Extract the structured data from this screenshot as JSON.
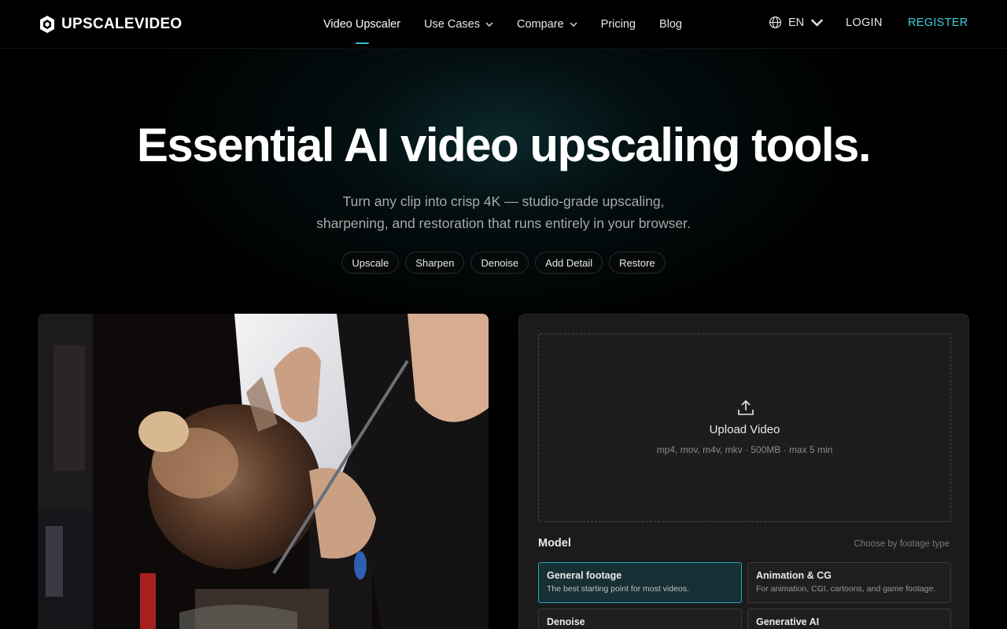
{
  "brand": {
    "name": "UPSCALEVIDEO",
    "icon": "cube-logo-icon"
  },
  "nav": {
    "items": [
      {
        "label": "Video Upscaler",
        "active": true,
        "dropdown": false
      },
      {
        "label": "Use Cases",
        "active": false,
        "dropdown": true
      },
      {
        "label": "Compare",
        "active": false,
        "dropdown": true
      },
      {
        "label": "Pricing",
        "active": false,
        "dropdown": false
      },
      {
        "label": "Blog",
        "active": false,
        "dropdown": false
      }
    ],
    "language": "EN",
    "login": "LOGIN",
    "register": "REGISTER"
  },
  "hero": {
    "title": "Essential AI video upscaling tools.",
    "subtitle_line1": "Turn any clip into crisp 4K — studio-grade upscaling,",
    "subtitle_line2": "sharpening, and restoration that runs entirely in your browser.",
    "chips": [
      "Upscale",
      "Sharpen",
      "Denoise",
      "Add Detail",
      "Restore"
    ]
  },
  "upload": {
    "title": "Upload Video",
    "hint": "mp4, mov, m4v, mkv · 500MB · max 5 min",
    "icon": "upload-icon"
  },
  "model": {
    "label": "Model",
    "hint": "Choose by footage type",
    "options": [
      {
        "title": "General footage",
        "desc": "The best starting point for most videos.",
        "selected": true
      },
      {
        "title": "Animation & CG",
        "desc": "For animation, CGI, cartoons, and game footage.",
        "selected": false
      },
      {
        "title": "Denoise",
        "desc": "",
        "selected": false
      },
      {
        "title": "Generative AI",
        "desc": "",
        "selected": false
      }
    ]
  },
  "colors": {
    "accent": "#3ccfdb",
    "background": "#000000",
    "panel": "#1b1b1b",
    "selected_card": "#173036"
  }
}
